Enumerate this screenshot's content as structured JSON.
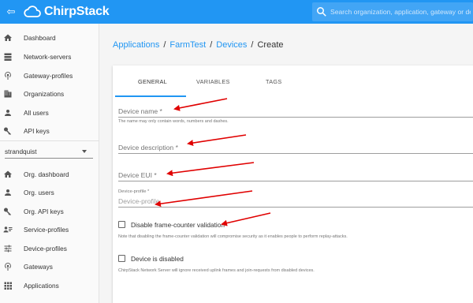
{
  "topbar": {
    "brand": "ChirpStack",
    "search_placeholder": "Search organization, application, gateway or device",
    "bg": "#2196f3"
  },
  "sidebar": {
    "global_items": [
      {
        "label": "Dashboard",
        "icon": "home-icon"
      },
      {
        "label": "Network-servers",
        "icon": "server-icon"
      },
      {
        "label": "Gateway-profiles",
        "icon": "radio-tower-icon"
      },
      {
        "label": "Organizations",
        "icon": "building-icon"
      },
      {
        "label": "All users",
        "icon": "account-icon"
      },
      {
        "label": "API keys",
        "icon": "key-icon"
      }
    ],
    "org_select": "strandquist",
    "org_items": [
      {
        "label": "Org. dashboard",
        "icon": "home-icon"
      },
      {
        "label": "Org. users",
        "icon": "account-icon"
      },
      {
        "label": "Org. API keys",
        "icon": "key-icon"
      },
      {
        "label": "Service-profiles",
        "icon": "account-details-icon"
      },
      {
        "label": "Device-profiles",
        "icon": "tune-icon"
      },
      {
        "label": "Gateways",
        "icon": "radio-tower-icon"
      },
      {
        "label": "Applications",
        "icon": "apps-icon"
      }
    ]
  },
  "breadcrumb": {
    "applications": "Applications",
    "farm": "FarmTest",
    "devices": "Devices",
    "current": "Create",
    "sep": "/"
  },
  "tabs": {
    "general": "GENERAL",
    "variables": "VARIABLES",
    "tags": "TAGS"
  },
  "form": {
    "device_name_label": "Device name *",
    "device_name_helper": "The name may only contain words, numbers and dashes.",
    "device_description_label": "Device description *",
    "device_eui_label": "Device EUI *",
    "device_profile_label": "Device-profile *",
    "device_profile_placeholder": "Device-profile",
    "disable_fcnt_label": "Disable frame-counter validation",
    "disable_fcnt_note": "Note that disabling the frame-counter validation will compromise security as it enables people to perform replay-attacks.",
    "device_disabled_label": "Device is disabled",
    "device_disabled_note": "ChirpStack Network Server will ignore received uplink frames and join-requests from disabled devices."
  },
  "annotation_color": "#e00000",
  "accent": "#2196f3"
}
